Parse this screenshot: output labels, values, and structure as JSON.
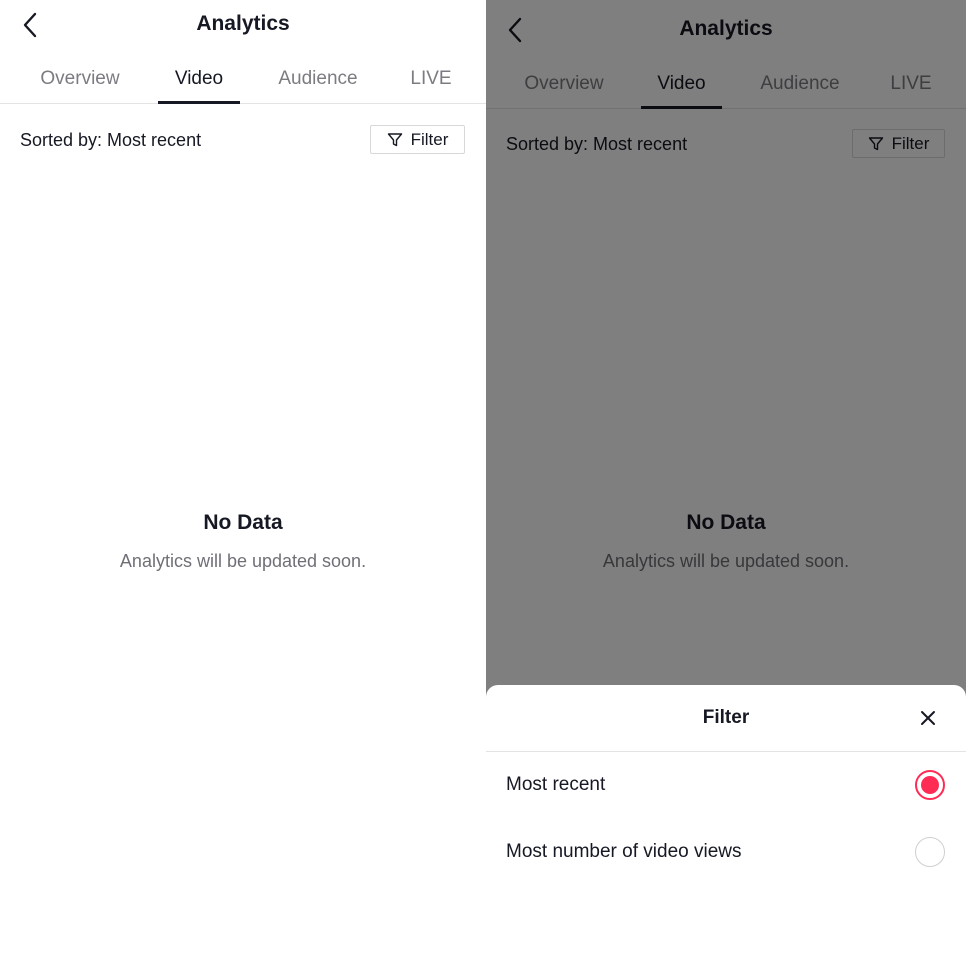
{
  "header": {
    "title": "Analytics"
  },
  "tabs": [
    {
      "label": "Overview",
      "active": false
    },
    {
      "label": "Video",
      "active": true
    },
    {
      "label": "Audience",
      "active": false
    },
    {
      "label": "LIVE",
      "active": false
    }
  ],
  "toolbar": {
    "sort_label": "Sorted by: Most recent",
    "filter_label": "Filter"
  },
  "empty_state": {
    "title": "No Data",
    "subtitle": "Analytics will be updated soon."
  },
  "filter_sheet": {
    "title": "Filter",
    "options": [
      {
        "label": "Most recent",
        "selected": true
      },
      {
        "label": "Most number of video views",
        "selected": false
      }
    ]
  },
  "colors": {
    "accent": "#fe2c55",
    "text": "#161823",
    "muted": "#7b7c82",
    "overlay": "rgba(0,0,0,0.5)"
  },
  "icons": {
    "back": "chevron-left-icon",
    "filter": "funnel-icon",
    "close": "close-icon"
  }
}
